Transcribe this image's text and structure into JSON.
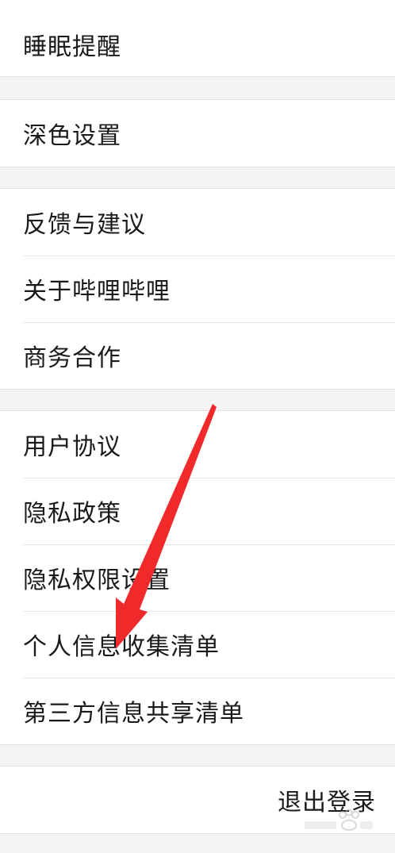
{
  "settings": {
    "group_sleep": [
      "睡眠提醒"
    ],
    "group_theme": [
      "深色设置"
    ],
    "group_about": [
      "反馈与建议",
      "关于哔哩哔哩",
      "商务合作"
    ],
    "group_legal": [
      "用户协议",
      "隐私政策",
      "隐私权限设置",
      "个人信息收集清单",
      "第三方信息共享清单"
    ],
    "logout_label": "退出登录"
  },
  "colors": {
    "background": "#f4f4f4",
    "row": "#ffffff",
    "text": "#1a1a1a",
    "annotation_arrow": "#f02a2a"
  },
  "annotation": {
    "arrow_icon": "red-pointer-arrow-icon",
    "watermark_icon": "baidu-watermark-icon"
  }
}
